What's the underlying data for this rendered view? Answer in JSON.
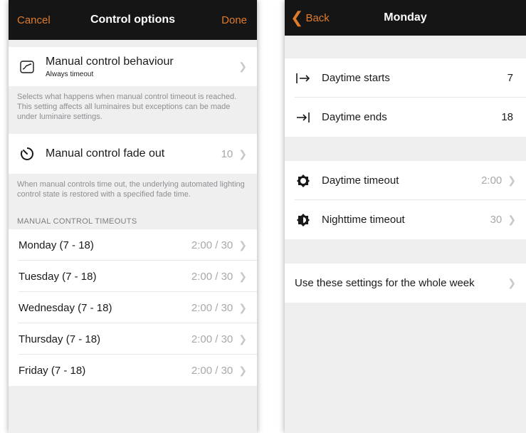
{
  "left": {
    "nav": {
      "cancel": "Cancel",
      "title": "Control options",
      "done": "Done"
    },
    "behaviour": {
      "icon": "curve-graph-icon",
      "title": "Manual control behaviour",
      "subtitle": "Always timeout"
    },
    "behaviour_footer": "Selects what happens when manual control timeout is reached. This setting affects all luminaires but exceptions can be made under luminaire settings.",
    "fade": {
      "icon": "timer-icon",
      "title": "Manual control fade out",
      "value": "10"
    },
    "fade_footer": "When manual controls time out, the underlying automated lighting control state is restored with a specified fade time.",
    "timeouts_header": "MANUAL CONTROL TIMEOUTS",
    "days": [
      {
        "label": "Monday (7 - 18)",
        "value": "2:00 / 30"
      },
      {
        "label": "Tuesday (7 - 18)",
        "value": "2:00 / 30"
      },
      {
        "label": "Wednesday (7 - 18)",
        "value": "2:00 / 30"
      },
      {
        "label": "Thursday (7 - 18)",
        "value": "2:00 / 30"
      },
      {
        "label": "Friday (7 - 18)",
        "value": "2:00 / 30"
      }
    ]
  },
  "right": {
    "nav": {
      "back": "Back",
      "title": "Monday"
    },
    "daytime_starts": {
      "icon": "bar-arrow-right-icon",
      "label": "Daytime starts",
      "value": "7"
    },
    "daytime_ends": {
      "icon": "arrow-to-bar-icon",
      "label": "Daytime ends",
      "value": "18"
    },
    "daytime_timeout": {
      "icon": "sun-icon",
      "label": "Daytime timeout",
      "value": "2:00"
    },
    "nighttime_timeout": {
      "icon": "half-sun-icon",
      "label": "Nighttime timeout",
      "value": "30"
    },
    "whole_week": {
      "label": "Use these settings for the whole week"
    }
  },
  "colors": {
    "accent": "#e07b2c",
    "navbar": "#151515",
    "background": "#efefef"
  }
}
